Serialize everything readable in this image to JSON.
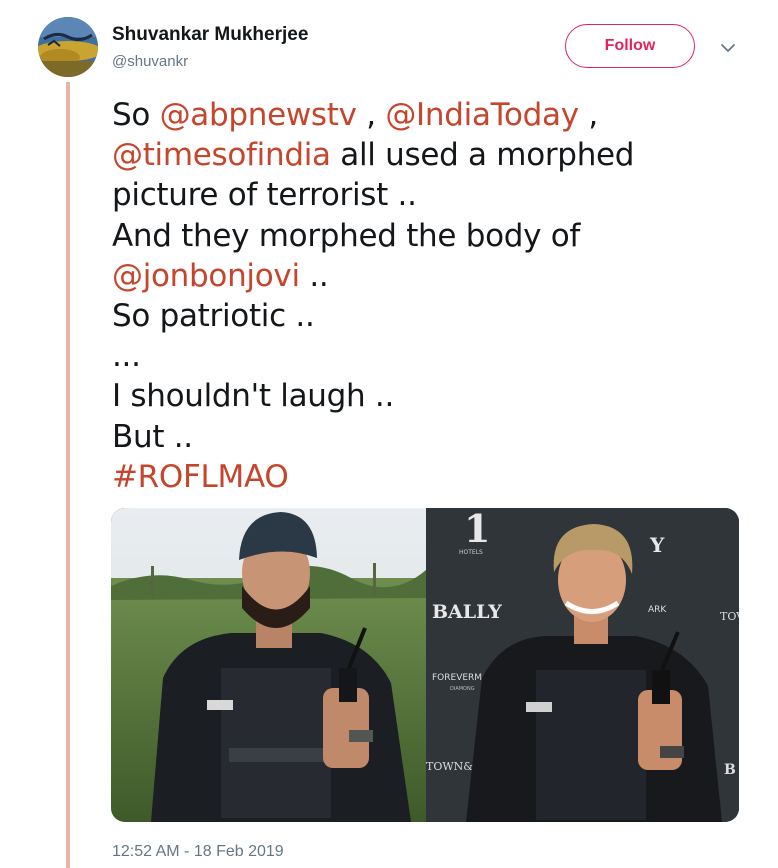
{
  "author": {
    "name": "Shuvankar Mukherjee",
    "handle": "@shuvankr"
  },
  "follow_button": {
    "label": "Follow"
  },
  "menu": {
    "icon": "chevron-down-icon"
  },
  "tweet": {
    "lines": [
      [
        {
          "t": "text",
          "v": "So "
        },
        {
          "t": "mention",
          "v": "@abpnewstv"
        },
        {
          "t": "text",
          "v": " , "
        },
        {
          "t": "mention",
          "v": "@IndiaToday"
        },
        {
          "t": "text",
          "v": " ,"
        }
      ],
      [
        {
          "t": "mention",
          "v": "@timesofindia"
        },
        {
          "t": "text",
          "v": " all used a morphed"
        }
      ],
      [
        {
          "t": "text",
          "v": "picture of terrorist .."
        }
      ],
      [
        {
          "t": "text",
          "v": "And they morphed the body of"
        }
      ],
      [
        {
          "t": "mention",
          "v": "@jonbonjovi"
        },
        {
          "t": "text",
          "v": " .."
        }
      ],
      [
        {
          "t": "text",
          "v": "So patriotic .."
        }
      ],
      [
        {
          "t": "text",
          "v": "..."
        }
      ],
      [
        {
          "t": "text",
          "v": "I shouldn't laugh .."
        }
      ],
      [
        {
          "t": "text",
          "v": "But .."
        }
      ],
      [
        {
          "t": "hashtag",
          "v": "#ROFLMAO"
        }
      ]
    ]
  },
  "media": {
    "left_photo": {
      "type": "outdoor-portrait"
    },
    "right_photo": {
      "type": "event-backdrop-portrait",
      "backdrop_text": {
        "logo_number": "1",
        "logo_sub": "HOTELS",
        "brand": "BALLY",
        "brand2": "FOREVERMA",
        "brand2_sub": "DIAMONG",
        "town": "TOWN&",
        "edge_tow": "TOV",
        "edge_ark": "ARK",
        "edge_y": "Y",
        "edge_b": "B"
      }
    }
  },
  "timestamp": "12:52 AM - 18 Feb 2019",
  "colors": {
    "link": "#c5452d",
    "follow": "#e0245e",
    "thread": "#e4b7a7",
    "muted": "#657786"
  }
}
